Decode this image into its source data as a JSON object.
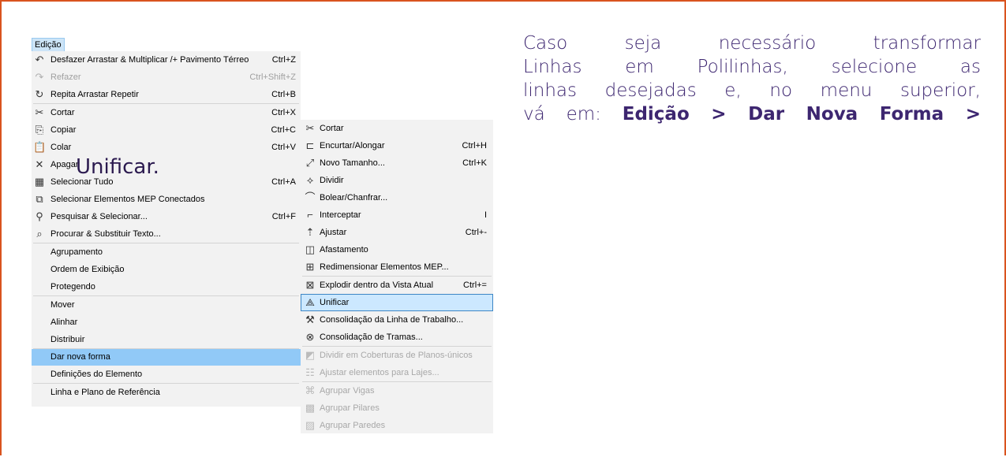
{
  "menu": {
    "title": "Edição",
    "items": [
      {
        "icon": "undo-icon",
        "glyph": "↶",
        "label": "Desfazer Arrastar & Multiplicar /+ Pavimento Térreo",
        "shortcut": "Ctrl+Z",
        "disabled": false
      },
      {
        "icon": "redo-icon",
        "glyph": "↷",
        "label": "Refazer",
        "shortcut": "Ctrl+Shift+Z",
        "disabled": true
      },
      {
        "icon": "repeat-icon",
        "glyph": "↻",
        "label": "Repita Arrastar  Repetir",
        "shortcut": "Ctrl+B",
        "disabled": false
      },
      {
        "icon": "scissors-icon",
        "glyph": "✂",
        "label": "Cortar",
        "shortcut": "Ctrl+X",
        "disabled": false
      },
      {
        "icon": "copy-icon",
        "glyph": "⎘",
        "label": "Copiar",
        "shortcut": "Ctrl+C",
        "disabled": false
      },
      {
        "icon": "paste-icon",
        "glyph": "📋",
        "label": "Colar",
        "shortcut": "Ctrl+V",
        "disabled": false
      },
      {
        "icon": "delete-icon",
        "glyph": "✕",
        "label": "Apagar",
        "shortcut": "",
        "disabled": false
      },
      {
        "icon": "select-all-icon",
        "glyph": "▦",
        "label": "Selecionar Tudo",
        "shortcut": "Ctrl+A",
        "disabled": false
      },
      {
        "icon": "mep-connected-icon",
        "glyph": "⧉",
        "label": "Selecionar Elementos MEP Conectados",
        "shortcut": "",
        "disabled": false
      },
      {
        "icon": "find-select-icon",
        "glyph": "⚲",
        "label": "Pesquisar & Selecionar...",
        "shortcut": "Ctrl+F",
        "disabled": false
      },
      {
        "icon": "find-replace-text-icon",
        "glyph": "⌕",
        "label": "Procurar & Substituir Texto...",
        "shortcut": "",
        "disabled": false
      },
      {
        "icon": "",
        "glyph": "",
        "label": "Agrupamento",
        "shortcut": "",
        "disabled": false
      },
      {
        "icon": "",
        "glyph": "",
        "label": "Ordem de Exibição",
        "shortcut": "",
        "disabled": false
      },
      {
        "icon": "",
        "glyph": "",
        "label": "Protegendo",
        "shortcut": "",
        "disabled": false
      },
      {
        "icon": "",
        "glyph": "",
        "label": "Mover",
        "shortcut": "",
        "disabled": false
      },
      {
        "icon": "",
        "glyph": "",
        "label": "Alinhar",
        "shortcut": "",
        "disabled": false
      },
      {
        "icon": "",
        "glyph": "",
        "label": "Distribuir",
        "shortcut": "",
        "disabled": false
      },
      {
        "icon": "",
        "glyph": "",
        "label": "Dar nova forma",
        "shortcut": "",
        "disabled": false,
        "highlighted": true
      },
      {
        "icon": "",
        "glyph": "",
        "label": "Definições do Elemento",
        "shortcut": "",
        "disabled": false
      },
      {
        "icon": "",
        "glyph": "",
        "label": "Linha e Plano de Referência",
        "shortcut": "",
        "disabled": false
      }
    ]
  },
  "submenu": {
    "items": [
      {
        "icon": "cut-element-icon",
        "glyph": "✂",
        "label": "Cortar",
        "shortcut": "",
        "disabled": false
      },
      {
        "icon": "trim-extend-icon",
        "glyph": "⊏",
        "label": "Encurtar/Alongar",
        "shortcut": "Ctrl+H",
        "disabled": false
      },
      {
        "icon": "resize-icon",
        "glyph": "⤢",
        "label": "Novo Tamanho...",
        "shortcut": "Ctrl+K",
        "disabled": false
      },
      {
        "icon": "split-icon",
        "glyph": "⟡",
        "label": "Dividir",
        "shortcut": "",
        "disabled": false
      },
      {
        "icon": "fillet-chamfer-icon",
        "glyph": "⌒",
        "label": "Bolear/Chanfrar...",
        "shortcut": "",
        "disabled": false
      },
      {
        "icon": "intersect-icon",
        "glyph": "⌐",
        "label": "Interceptar",
        "shortcut": "I",
        "disabled": false
      },
      {
        "icon": "adjust-icon",
        "glyph": "⇡",
        "label": "Ajustar",
        "shortcut": "Ctrl+-",
        "disabled": false
      },
      {
        "icon": "offset-icon",
        "glyph": "◫",
        "label": "Afastamento",
        "shortcut": "",
        "disabled": false
      },
      {
        "icon": "resize-mep-icon",
        "glyph": "⊞",
        "label": "Redimensionar Elementos MEP...",
        "shortcut": "",
        "disabled": false
      },
      {
        "icon": "explode-icon",
        "glyph": "⊠",
        "label": "Explodir dentro da Vista Atual",
        "shortcut": "Ctrl+=",
        "disabled": false
      },
      {
        "icon": "unify-icon",
        "glyph": "⟁",
        "label": "Unificar",
        "shortcut": "",
        "disabled": false,
        "highlighted": true
      },
      {
        "icon": "line-consolidation-icon",
        "glyph": "⚒",
        "label": "Consolidação da Linha de Trabalho...",
        "shortcut": "",
        "disabled": false
      },
      {
        "icon": "hatch-consolidation-icon",
        "glyph": "⊗",
        "label": "Consolidação de Tramas...",
        "shortcut": "",
        "disabled": false
      },
      {
        "icon": "split-roofs-icon",
        "glyph": "◩",
        "label": "Dividir em Coberturas de Planos-únicos",
        "shortcut": "",
        "disabled": true
      },
      {
        "icon": "adjust-slabs-icon",
        "glyph": "☷",
        "label": "Ajustar elementos para Lajes...",
        "shortcut": "",
        "disabled": true
      },
      {
        "icon": "group-beams-icon",
        "glyph": "⌘",
        "label": "Agrupar Vigas",
        "shortcut": "",
        "disabled": true
      },
      {
        "icon": "group-columns-icon",
        "glyph": "▩",
        "label": "Agrupar Pilares",
        "shortcut": "",
        "disabled": true
      },
      {
        "icon": "group-walls-icon",
        "glyph": "▨",
        "label": "Agrupar Paredes",
        "shortcut": "",
        "disabled": true
      }
    ]
  },
  "overlay_text": "Unificar.",
  "paragraph": {
    "line1": "Caso  seja  necessário  transformar",
    "line2": "Linhas  em  Polilinhas,  selecione  as",
    "line3": "linhas desejadas e, no menu superior,",
    "line4_prefix": "vá em: ",
    "line4_bold": "Edição > Dar Nova Forma >"
  },
  "colors": {
    "frame_border": "#d9531e",
    "text_purple": "#3d2670",
    "highlight_blue": "#91c9f7"
  }
}
